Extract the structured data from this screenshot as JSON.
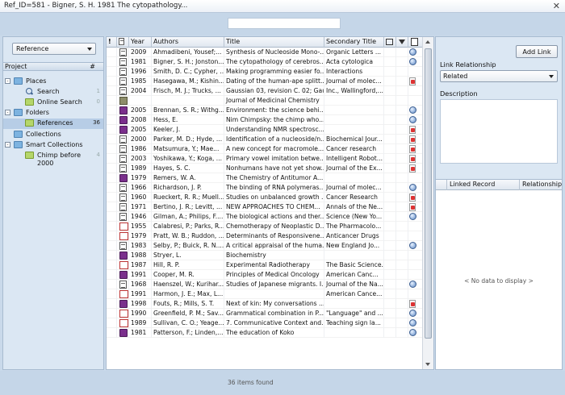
{
  "window": {
    "title": "Ref_ID=581 - Bigner, S. H. 1981  The cytopathology...",
    "close_glyph": "✕"
  },
  "status": {
    "items_found": "36  items found"
  },
  "left": {
    "dropdown_value": "Reference",
    "project_header": {
      "label": "Project",
      "count_header": "#"
    },
    "tree": [
      {
        "label": "Places",
        "indent": 0,
        "icon": "folder-icon",
        "toggle": "-"
      },
      {
        "label": "Search",
        "indent": 2,
        "icon": "magnifier-icon",
        "count": "1"
      },
      {
        "label": "Online Search",
        "indent": 2,
        "icon": "green-folder-icon",
        "count": "0"
      },
      {
        "label": "Folders",
        "indent": 0,
        "icon": "folder-icon",
        "toggle": "-"
      },
      {
        "label": "References",
        "indent": 2,
        "icon": "green-folder-icon",
        "count": "36",
        "selected": true
      },
      {
        "label": "Collections",
        "indent": 0,
        "icon": "folder-icon"
      },
      {
        "label": "Smart Collections",
        "indent": 0,
        "icon": "folder-icon",
        "toggle": "-"
      },
      {
        "label": "Chimp before",
        "label2": "2000",
        "indent": 2,
        "icon": "green-folder-icon",
        "count": "4"
      }
    ]
  },
  "grid": {
    "columns": {
      "flag": "!",
      "type": "",
      "year": "Year",
      "authors": "Authors",
      "title": "Title",
      "secondary": "Secondary Title"
    },
    "rows": [
      {
        "t": "doc",
        "year": "2009",
        "authors": "Ahmadibeni, Yousef;...",
        "title": "Synthesis of Nucleoside Mono-...",
        "sec": "Organic Letters ...",
        "a": "globe"
      },
      {
        "t": "doc",
        "year": "1981",
        "authors": "Bigner, S. H.; Jonston...",
        "title": "The cytopathology of cerebros...",
        "sec": "Acta cytologica",
        "a": "globe"
      },
      {
        "t": "doc",
        "year": "1996",
        "authors": "Smith, D. C.; Cypher, ...",
        "title": "Making programming easier fo...",
        "sec": "Interactions",
        "a": ""
      },
      {
        "t": "doc",
        "year": "1985",
        "authors": "Hasegawa, M.; Kishin...",
        "title": "Dating of the human-ape splitt...",
        "sec": "Journal of molec...",
        "a": "pdf"
      },
      {
        "t": "doc",
        "year": "2004",
        "authors": "Frisch, M. J.; Trucks, ...",
        "title": "Gaussian 03, revision C. 02; Gau...",
        "sec": "Inc., Wallingford,...",
        "a": ""
      },
      {
        "t": "journal",
        "year": "",
        "authors": "",
        "title": "Journal of Medicinal Chemistry",
        "sec": "",
        "a": ""
      },
      {
        "t": "book",
        "year": "2005",
        "authors": "Brennan, S. R.; Withg...",
        "title": "Environment: the science behi...",
        "sec": "",
        "a": "globe"
      },
      {
        "t": "book",
        "year": "2008",
        "authors": "Hess, E.",
        "title": "Nim Chimpsky: the chimp who...",
        "sec": "",
        "a": "globe"
      },
      {
        "t": "book",
        "year": "2005",
        "authors": "Keeler, J.",
        "title": "Understanding NMR spectrosc...",
        "sec": "",
        "a": "pdf"
      },
      {
        "t": "doc",
        "year": "2000",
        "authors": "Parker, M. D.; Hyde, ...",
        "title": "Identification of a nucleoside/n...",
        "sec": "Biochemical Jour...",
        "a": "pdf"
      },
      {
        "t": "doc",
        "year": "1986",
        "authors": "Matsumura, Y.; Mae...",
        "title": "A new concept for macromole...",
        "sec": "Cancer research",
        "a": "pdf"
      },
      {
        "t": "doc",
        "year": "2003",
        "authors": "Yoshikawa, Y.; Koga, ...",
        "title": "Primary vowel imitation betwe...",
        "sec": "Intelligent Robot...",
        "a": "pdf"
      },
      {
        "t": "doc",
        "year": "1989",
        "authors": "Hayes, S. C.",
        "title": "Nonhumans have not yet show...",
        "sec": "Journal of the Ex...",
        "a": "pdf"
      },
      {
        "t": "book",
        "year": "1979",
        "authors": "Remers, W. A.",
        "title": "The Chemistry of Antitumor A...",
        "sec": "",
        "a": ""
      },
      {
        "t": "doc",
        "year": "1966",
        "authors": "Richardson, J. P.",
        "title": "The binding of RNA polymeras...",
        "sec": "Journal of molec...",
        "a": "globe"
      },
      {
        "t": "doc",
        "year": "1960",
        "authors": "Rueckert, R. R.; Muell...",
        "title": "Studies on unbalanced growth ...",
        "sec": "Cancer Research",
        "a": "pdf"
      },
      {
        "t": "doc",
        "year": "1971",
        "authors": "Bertino, J. R.; Levitt, ...",
        "title": "NEW APPROACHES TO CHEM...",
        "sec": "Annals of the Ne...",
        "a": "pdf"
      },
      {
        "t": "doc",
        "year": "1946",
        "authors": "Gilman, A.; Philips, F....",
        "title": "The biological actions and ther...",
        "sec": "Science (New Yo...",
        "a": "globe"
      },
      {
        "t": "paper",
        "year": "1955",
        "authors": "Calabresi, P.; Parks, R...",
        "title": "Chemotherapy of Neoplastic D...",
        "sec": "The Pharmacolo...",
        "a": ""
      },
      {
        "t": "paper",
        "year": "1979",
        "authors": "Pratt, W. B.; Ruddon, ...",
        "title": "Determinants of Responsivene...",
        "sec": "Anticancer Drugs",
        "a": ""
      },
      {
        "t": "doc",
        "year": "1983",
        "authors": "Selby, P.; Buick, R. N....",
        "title": "A critical appraisal of the huma...",
        "sec": "New England Jo...",
        "a": "globe"
      },
      {
        "t": "book",
        "year": "1988",
        "authors": "Stryer, L.",
        "title": "Biochemistry",
        "sec": "",
        "a": ""
      },
      {
        "t": "paper",
        "year": "1987",
        "authors": "Hill, R. P.",
        "title": "Experimental Radiotherapy",
        "sec": "The Basic Science...",
        "a": ""
      },
      {
        "t": "book",
        "year": "1991",
        "authors": "Cooper, M. R.",
        "title": "Principles of Medical Oncology",
        "sec": "American Canc...",
        "a": ""
      },
      {
        "t": "doc",
        "year": "1968",
        "authors": "Haenszel, W.; Kurihar...",
        "title": "Studies of Japanese migrants. I...",
        "sec": "Journal of the Na...",
        "a": "globe"
      },
      {
        "t": "paper",
        "year": "1991",
        "authors": "Harmon, J. E.; Max, L....",
        "title": "",
        "sec": "American Cance...",
        "a": ""
      },
      {
        "t": "book",
        "year": "1998",
        "authors": "Fouts, R.; Mills, S. T.",
        "title": "Next of kin: My conversations ...",
        "sec": "",
        "a": "pdf"
      },
      {
        "t": "paper",
        "year": "1990",
        "authors": "Greenfield, P. M.; Sav...",
        "title": "Grammatical combination in P...",
        "sec": "\"Language\" and ...",
        "a": "globe"
      },
      {
        "t": "paper",
        "year": "1989",
        "authors": "Sullivan, C. O.; Yeage...",
        "title": "7. Communicative Context and...",
        "sec": "Teaching sign la...",
        "a": "globe"
      },
      {
        "t": "book",
        "year": "1981",
        "authors": "Patterson, F.; Linden,...",
        "title": "The education of Koko",
        "sec": "",
        "a": "globe"
      }
    ]
  },
  "right": {
    "add_link_label": "Add Link",
    "link_relationship_label": "Link Relationship",
    "link_relationship_value": "Related",
    "description_label": "Description",
    "linked_columns": {
      "record": "Linked Record",
      "relationship": "Relationship"
    },
    "no_data": "< No data to display >"
  }
}
